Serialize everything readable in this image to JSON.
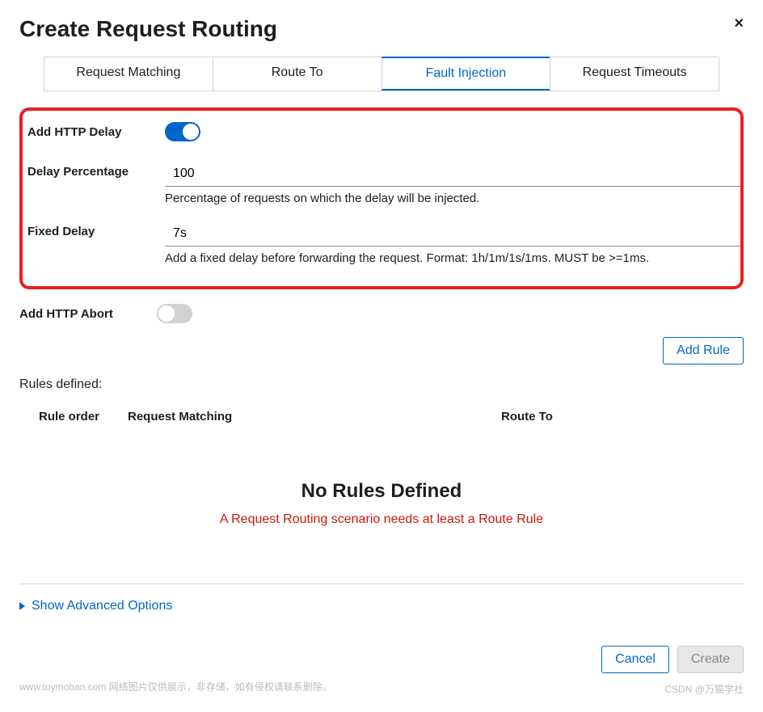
{
  "dialog": {
    "title": "Create Request Routing",
    "close_icon": "×"
  },
  "tabs": [
    {
      "label": "Request Matching",
      "active": false
    },
    {
      "label": "Route To",
      "active": false
    },
    {
      "label": "Fault Injection",
      "active": true
    },
    {
      "label": "Request Timeouts",
      "active": false
    }
  ],
  "fault_injection": {
    "http_delay": {
      "label": "Add HTTP Delay",
      "enabled": true
    },
    "delay_percentage": {
      "label": "Delay Percentage",
      "value": "100",
      "help": "Percentage of requests on which the delay will be injected."
    },
    "fixed_delay": {
      "label": "Fixed Delay",
      "value": "7s",
      "help": "Add a fixed delay before forwarding the request. Format: 1h/1m/1s/1ms. MUST be >=1ms."
    },
    "http_abort": {
      "label": "Add HTTP Abort",
      "enabled": false
    }
  },
  "buttons": {
    "add_rule": "Add Rule",
    "cancel": "Cancel",
    "create": "Create"
  },
  "rules": {
    "section_title": "Rules defined:",
    "columns": {
      "order": "Rule order",
      "matching": "Request Matching",
      "route_to": "Route To"
    },
    "empty": {
      "title": "No Rules Defined",
      "message": "A Request Routing scenario needs at least a Route Rule"
    }
  },
  "advanced": {
    "label": "Show Advanced Options"
  },
  "watermarks": {
    "footer_left": "www.toymoban.com 网络图片仅供展示，非存储，如有侵权请联系删除。",
    "footer_right": "CSDN @万猫学社"
  }
}
